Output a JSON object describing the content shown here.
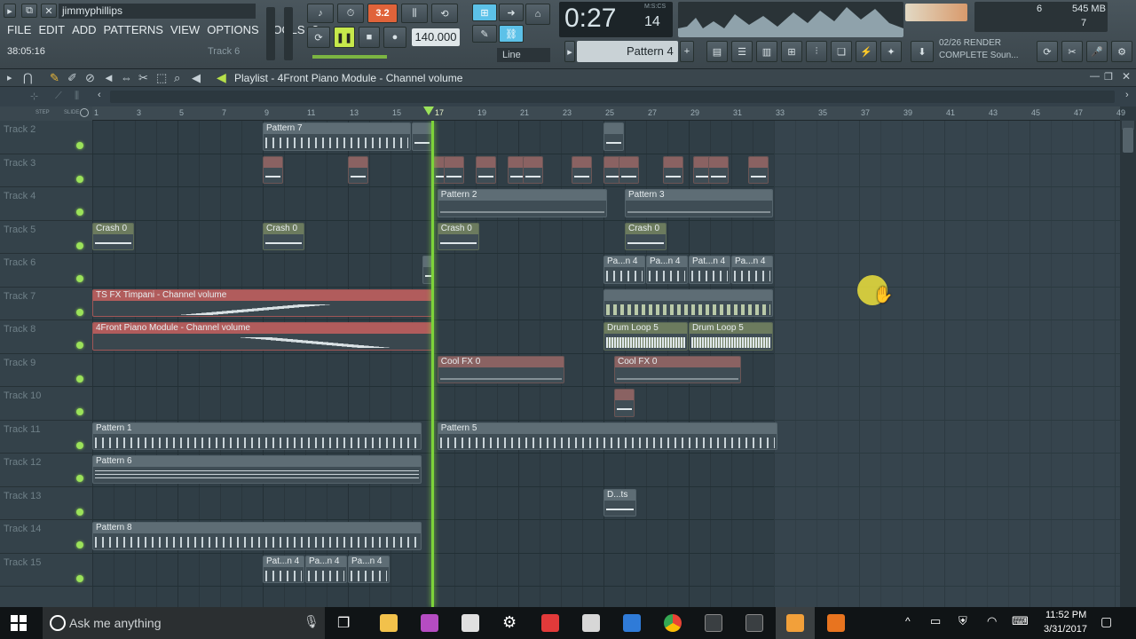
{
  "user": "jimmyphillips",
  "menu": [
    "FILE",
    "EDIT",
    "ADD",
    "PATTERNS",
    "VIEW",
    "OPTIONS",
    "TOOLS",
    "?"
  ],
  "hint": {
    "time": "38:05:16",
    "track": "Track 6"
  },
  "transport": {
    "tempo": "140.000",
    "mode": "Line"
  },
  "clock": {
    "value": "0:27",
    "sub": "14",
    "format": "M:S:CS"
  },
  "pattern_selector": "Pattern 4",
  "monitor": {
    "cpu": "6",
    "mem": "545 MB",
    "poly": "7"
  },
  "render": {
    "line1": "02/26  RENDER",
    "line2": "COMPLETE Soun..."
  },
  "playlist": {
    "title": "Playlist - 4Front Piano Module - Channel volume",
    "step": "STEP",
    "slide": "SLIDE"
  },
  "ruler": [
    "1",
    "3",
    "5",
    "7",
    "9",
    "11",
    "13",
    "15",
    "17",
    "19",
    "21",
    "23",
    "25",
    "27",
    "29",
    "31",
    "33",
    "35",
    "37",
    "39",
    "41",
    "43",
    "45",
    "47",
    "49"
  ],
  "tracks": [
    "Track 2",
    "Track 3",
    "Track 4",
    "Track 5",
    "Track 6",
    "Track 7",
    "Track 8",
    "Track 9",
    "Track 10",
    "Track 11",
    "Track 12",
    "Track 13",
    "Track 14",
    "Track 15"
  ],
  "clips": {
    "pattern7": "Pattern 7",
    "pattern2": "Pattern 2",
    "pattern3": "Pattern 3",
    "crash": "Crash 0",
    "pan4": "Pa...n 4",
    "pat4": "Pat...n 4",
    "timpani": "TS FX Timpani - Channel volume",
    "piano": "4Front Piano Module - Channel volume",
    "drumloop": "Drum Loop 5",
    "coolfx": "Cool FX 0",
    "pattern1": "Pattern 1",
    "pattern5": "Pattern 5",
    "pattern6": "Pattern 6",
    "pattern8": "Pattern 8",
    "dts": "D...ts"
  },
  "taskbar": {
    "search": "Ask me anything",
    "time": "11:52 PM",
    "date": "3/31/2017"
  },
  "colors": {
    "accent": "#9be25a",
    "playhead": "#7dd33a",
    "pattern_clip": "#5a6a72",
    "audio_clip": "#8a6565",
    "automation_clip": "#b05a5a"
  }
}
